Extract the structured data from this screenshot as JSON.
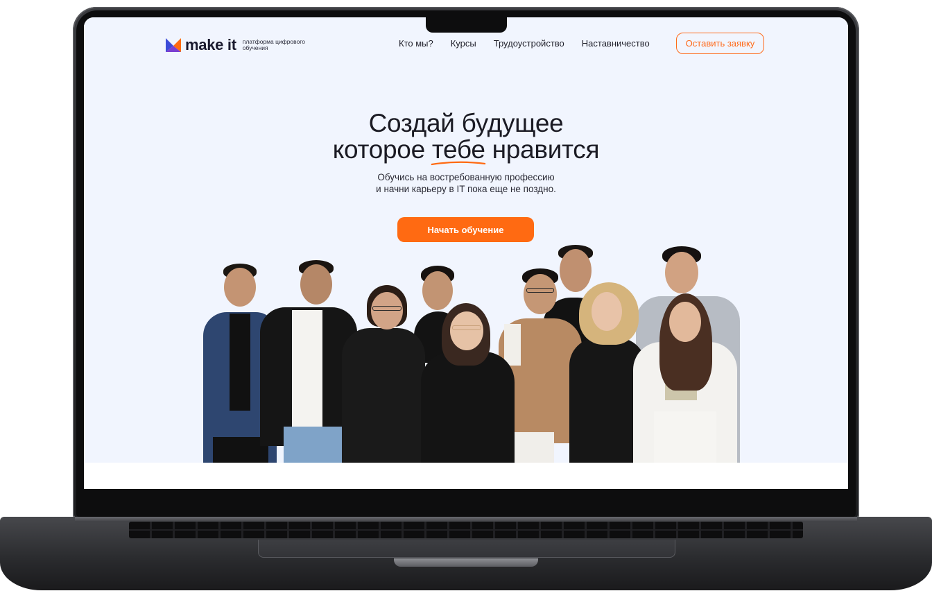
{
  "nav": {
    "logo_text": "make it",
    "logo_tagline": "платформа цифрового обучения",
    "links": [
      {
        "label": "Кто мы?"
      },
      {
        "label": "Курсы"
      },
      {
        "label": "Трудоустройство"
      },
      {
        "label": "Наставничество"
      }
    ],
    "cta_label": "Оставить заявку"
  },
  "hero": {
    "headline_line1": "Создай будущее",
    "headline_line2_before": "которое ",
    "headline_line2_highlight": "тебе",
    "headline_line2_after": " нравится",
    "subtitle_line1": "Обучись на востребованную профессию",
    "subtitle_line2": "и начни карьеру в IT пока еще не поздно.",
    "cta_label": "Начать обучение"
  },
  "colors": {
    "accent": "#ff6a12",
    "hero_background": "#f1f5fe",
    "text": "#1b1b24",
    "logo_blue": "#3b4bd8",
    "logo_orange": "#ff6a12",
    "logo_purple": "#7a3fd1"
  },
  "team_photo": {
    "people_count": 10
  }
}
